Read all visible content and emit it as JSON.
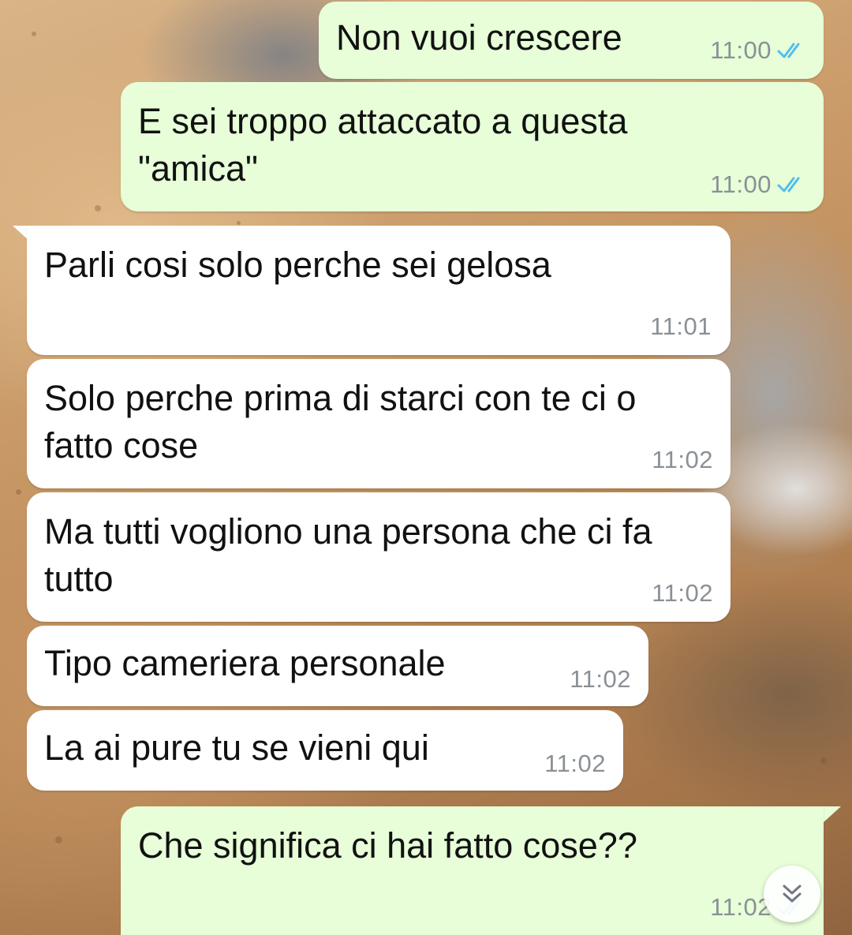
{
  "messages": [
    {
      "direction": "outgoing",
      "text": "Non vuoi crescere",
      "time": "11:00",
      "status": "read"
    },
    {
      "direction": "outgoing",
      "text": "E sei troppo attaccato a questa \"amica\"",
      "time": "11:00",
      "status": "read"
    },
    {
      "direction": "incoming",
      "text": "Parli cosi solo perche sei gelosa",
      "time": "11:01"
    },
    {
      "direction": "incoming",
      "text": "Solo perche prima di starci con te ci o fatto cose",
      "time": "11:02"
    },
    {
      "direction": "incoming",
      "text": "Ma tutti vogliono una persona che ci fa tutto",
      "time": "11:02"
    },
    {
      "direction": "incoming",
      "text": "Tipo cameriera personale",
      "time": "11:02"
    },
    {
      "direction": "incoming",
      "text": "La ai pure tu se vieni qui",
      "time": "11:02"
    },
    {
      "direction": "outgoing",
      "text": "Che significa ci hai fatto cose??",
      "time": "11:02",
      "status": "read"
    }
  ],
  "icons": {
    "read_ticks": "double-check-icon",
    "scroll_down": "double-chevron-down-icon"
  },
  "colors": {
    "outgoing_bubble": "#e7fed8",
    "incoming_bubble": "#ffffff",
    "read_tick": "#53bdeb",
    "timestamp": "#8a9095"
  }
}
